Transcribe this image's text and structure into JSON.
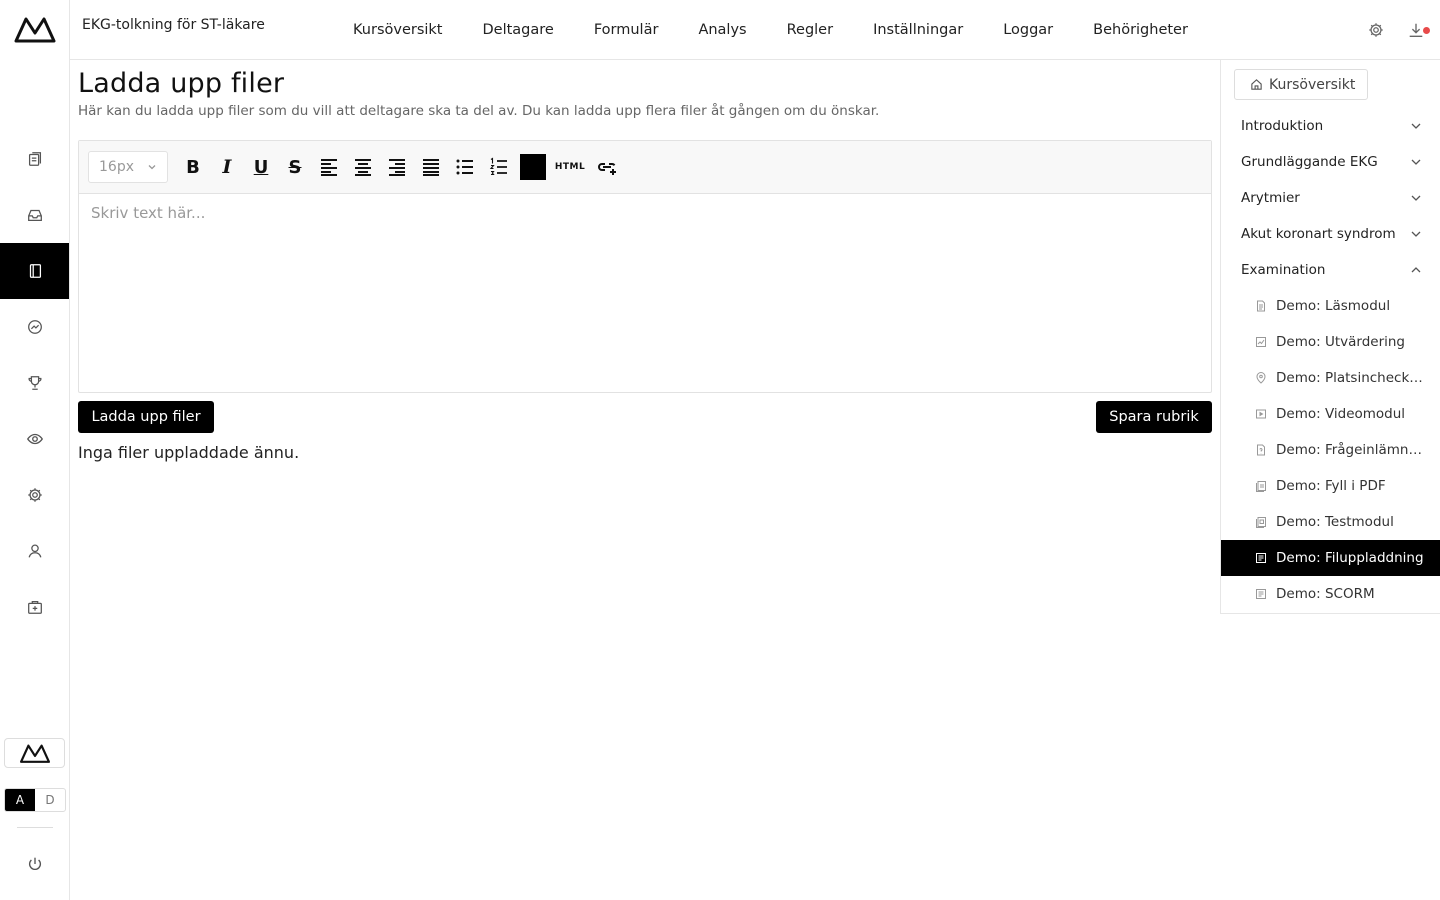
{
  "header": {
    "course_title": "EKG-tolkning för ST-läkare",
    "nav": [
      "Kursöversikt",
      "Deltagare",
      "Formulär",
      "Analys",
      "Regler",
      "Inställningar",
      "Loggar",
      "Behörigheter"
    ],
    "icons": [
      "gear-icon",
      "download-icon"
    ],
    "notification_color": "#e84a4a"
  },
  "rail": {
    "items": [
      "documents-icon",
      "inbox-icon",
      "notebook-icon",
      "analytics-icon",
      "trophy-icon",
      "eye-icon",
      "gear-icon",
      "user-icon",
      "first-aid-icon"
    ],
    "active_index": 2,
    "toggle": {
      "a": "A",
      "d": "D"
    }
  },
  "main": {
    "title": "Ladda upp filer",
    "description": "Här kan du ladda upp filer som du vill att deltagare ska ta del av. Du kan ladda upp flera filer åt gången om du önskar.",
    "editor": {
      "font_size": "16px",
      "placeholder": "Skriv text här...",
      "bold": "B",
      "italic": "I",
      "underline": "U",
      "strike": "S",
      "html_label": "HTML",
      "text_color": "#000000"
    },
    "upload_button": "Ladda upp filer",
    "save_button": "Spara rubrik",
    "empty_text": "Inga filer uppladdade ännu."
  },
  "sidebar": {
    "overview_button": "Kursöversikt",
    "sections": [
      {
        "label": "Introduktion",
        "expanded": false
      },
      {
        "label": "Grundläggande EKG",
        "expanded": false
      },
      {
        "label": "Arytmier",
        "expanded": false
      },
      {
        "label": "Akut koronart syndrom",
        "expanded": false
      },
      {
        "label": "Examination",
        "expanded": true
      }
    ],
    "modules": [
      {
        "label": "Demo: Läsmodul",
        "icon": "document-icon"
      },
      {
        "label": "Demo: Utvärdering",
        "icon": "chart-icon"
      },
      {
        "label": "Demo: Platsincheckning",
        "icon": "location-icon"
      },
      {
        "label": "Demo: Videomodul",
        "icon": "video-icon"
      },
      {
        "label": "Demo: Frågeinlämning",
        "icon": "file-question-icon"
      },
      {
        "label": "Demo: Fyll i PDF",
        "icon": "pdf-icon"
      },
      {
        "label": "Demo: Testmodul",
        "icon": "test-icon"
      },
      {
        "label": "Demo: Filuppladdning",
        "icon": "file-upload-icon",
        "active": true
      },
      {
        "label": "Demo: SCORM",
        "icon": "scorm-icon"
      }
    ]
  }
}
